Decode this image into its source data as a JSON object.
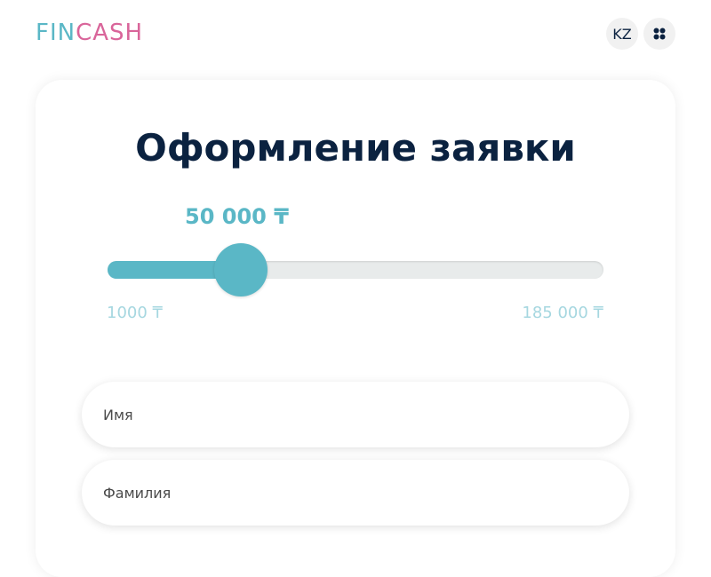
{
  "header": {
    "logo": {
      "part1": "FIN",
      "part2": "CASH"
    },
    "lang_label": "KZ",
    "menu_icon": "grid-icon"
  },
  "form": {
    "title": "Оформление заявки",
    "amount": {
      "display": "50 000 ₸",
      "value": 50000,
      "min": 1000,
      "max": 185000,
      "min_label": "1000 ₸",
      "max_label": "185 000 ₸",
      "fraction": 0.268
    },
    "fields": {
      "first_name": {
        "placeholder": "Имя",
        "value": ""
      },
      "last_name": {
        "placeholder": "Фамилия",
        "value": ""
      }
    }
  },
  "colors": {
    "accent": "#5ab7c6",
    "brand_pink": "#d9659a",
    "title": "#0b2240",
    "range_label": "#a6d7e0"
  }
}
